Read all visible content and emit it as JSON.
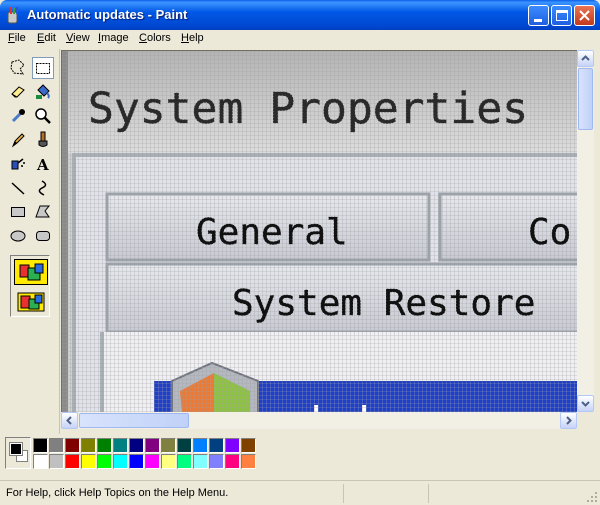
{
  "window": {
    "title": "Automatic updates - Paint"
  },
  "menu": [
    {
      "label": "File",
      "mnemonic": "F",
      "rest": "ile"
    },
    {
      "label": "Edit",
      "mnemonic": "E",
      "rest": "dit"
    },
    {
      "label": "View",
      "mnemonic": "V",
      "rest": "iew"
    },
    {
      "label": "Image",
      "mnemonic": "I",
      "rest": "mage"
    },
    {
      "label": "Colors",
      "mnemonic": "C",
      "rest": "olors"
    },
    {
      "label": "Help",
      "mnemonic": "H",
      "rest": "elp"
    }
  ],
  "tools": [
    "free-form-select",
    "select",
    "eraser",
    "fill-with-color",
    "pick-color",
    "magnifier",
    "pencil",
    "brush",
    "airbrush",
    "text",
    "line",
    "curve",
    "rectangle",
    "polygon",
    "ellipse",
    "rounded-rectangle"
  ],
  "canvas": {
    "heading": "System Properties",
    "tab1": "General",
    "tab2": "Co",
    "tab3": "System Restore",
    "accent_colors": {
      "background": "#C8C8C8",
      "heading_gradient_top": "#B8B8B8",
      "panel": "#E4E4EC",
      "tab_face": "#D4D6DE",
      "banner": "#1E3FC8"
    }
  },
  "palette": {
    "foreground": "#000000",
    "background": "#FFFFFF",
    "row1": [
      "#000000",
      "#808080",
      "#800000",
      "#808000",
      "#008000",
      "#008080",
      "#000080",
      "#800080",
      "#808040",
      "#004040",
      "#0080FF",
      "#004080",
      "#8000FF",
      "#804000"
    ],
    "row2": [
      "#FFFFFF",
      "#C0C0C0",
      "#FF0000",
      "#FFFF00",
      "#00FF00",
      "#00FFFF",
      "#0000FF",
      "#FF00FF",
      "#FFFF80",
      "#00FF80",
      "#80FFFF",
      "#8080FF",
      "#FF0080",
      "#FF8040"
    ]
  },
  "status": {
    "help": "For Help, click Help Topics on the Help Menu."
  }
}
